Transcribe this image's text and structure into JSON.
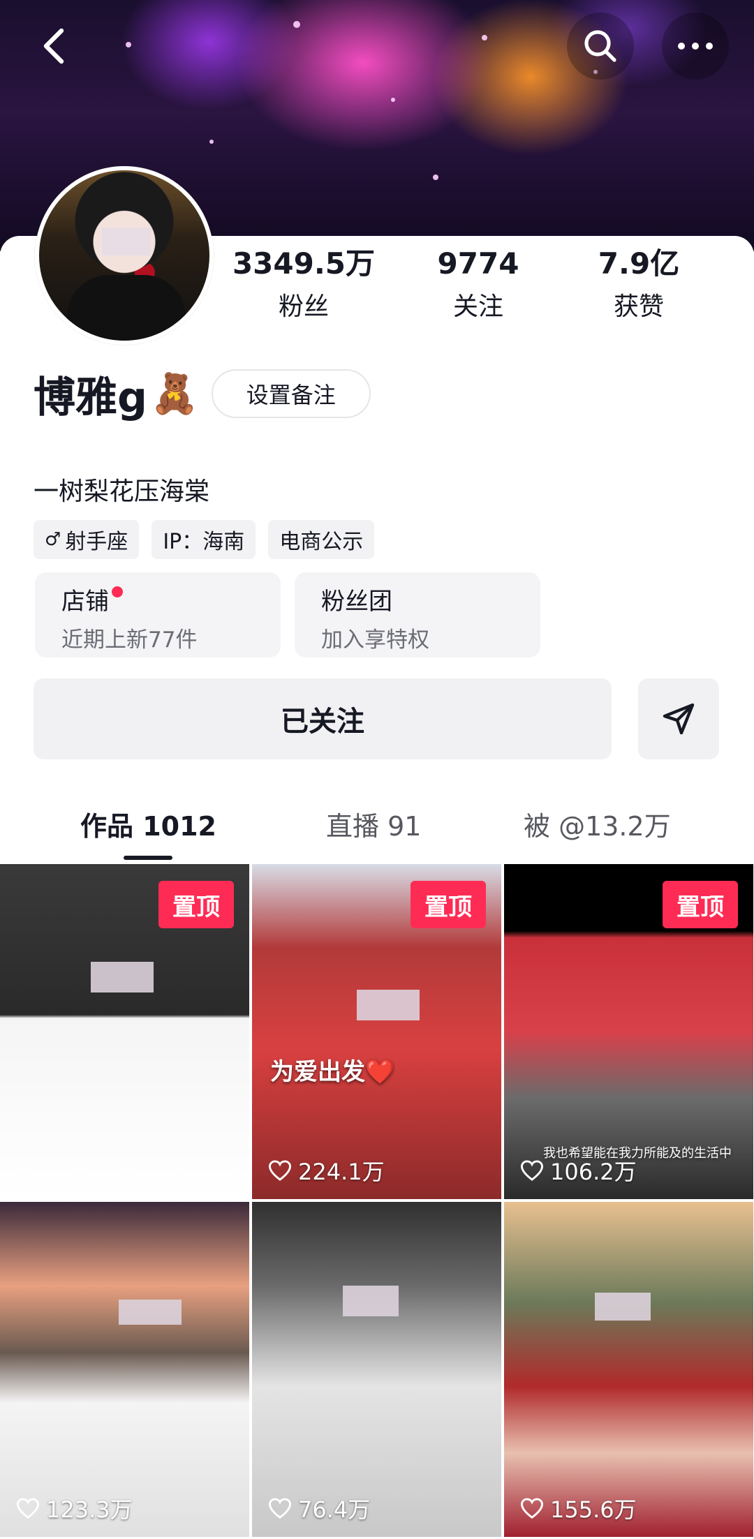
{
  "header": {
    "back_icon": "back-chevron-icon",
    "search_icon": "search-icon",
    "more_icon": "more-dots-icon"
  },
  "profile": {
    "stats": [
      {
        "value": "3349.5万",
        "label": "粉丝"
      },
      {
        "value": "9774",
        "label": "关注"
      },
      {
        "value": "7.9亿",
        "label": "获赞"
      }
    ],
    "name": "博雅g",
    "name_emoji": "🧸",
    "remark_button": "设置备注",
    "bio": "一树梨花压海棠",
    "tags": [
      {
        "icon": "♂",
        "label": "射手座"
      },
      {
        "label": "IP：海南"
      },
      {
        "label": "电商公示"
      }
    ],
    "entries": [
      {
        "title": "店铺",
        "subtitle": "近期上新77件",
        "has_dot": true
      },
      {
        "title": "粉丝团",
        "subtitle": "加入享特权"
      }
    ],
    "follow_button": "已关注",
    "send_icon": "send-message-icon"
  },
  "tabs": [
    {
      "label": "作品 1012",
      "active": true
    },
    {
      "label": "直播 91"
    },
    {
      "label": "被 @13.2万"
    }
  ],
  "videos": [
    {
      "pinned": "置顶",
      "likes": ""
    },
    {
      "pinned": "置顶",
      "likes": "224.1万",
      "caption": "为爱出发❤️"
    },
    {
      "pinned": "置顶",
      "likes": "106.2万",
      "caption": "我也希望能在我力所能及的生活中"
    },
    {
      "likes": "123.3万"
    },
    {
      "likes": "76.4万"
    },
    {
      "likes": "155.6万"
    }
  ],
  "colors": {
    "accent": "#fe2c55",
    "text": "#161823"
  }
}
